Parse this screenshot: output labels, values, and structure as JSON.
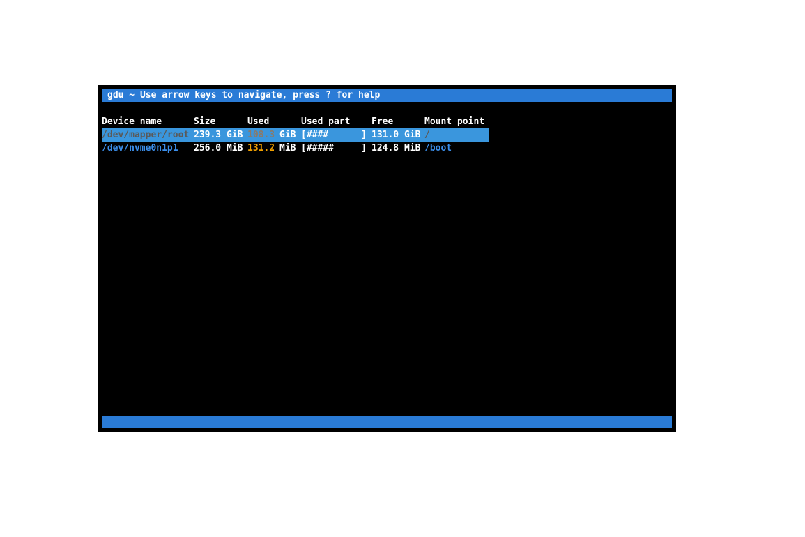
{
  "title": "gdu ~ Use arrow keys to navigate, press ? for help",
  "headers": [
    "Device name",
    "Size",
    "Used",
    "Used part",
    "Free",
    "Mount point"
  ],
  "rows": [
    {
      "device": "/dev/mapper/root",
      "size": "239.3 GiB",
      "used_num": "108.3",
      "used_unit": "GiB",
      "used_part": "[####      ]",
      "free": "131.0 GiB",
      "mount": "/",
      "selected": true
    },
    {
      "device": "/dev/nvme0n1p1",
      "size": "256.0 MiB",
      "used_num": "131.2",
      "used_unit": "MiB",
      "used_part": "[#####     ]",
      "free": "124.8 MiB",
      "mount": "/boot",
      "selected": false
    }
  ]
}
